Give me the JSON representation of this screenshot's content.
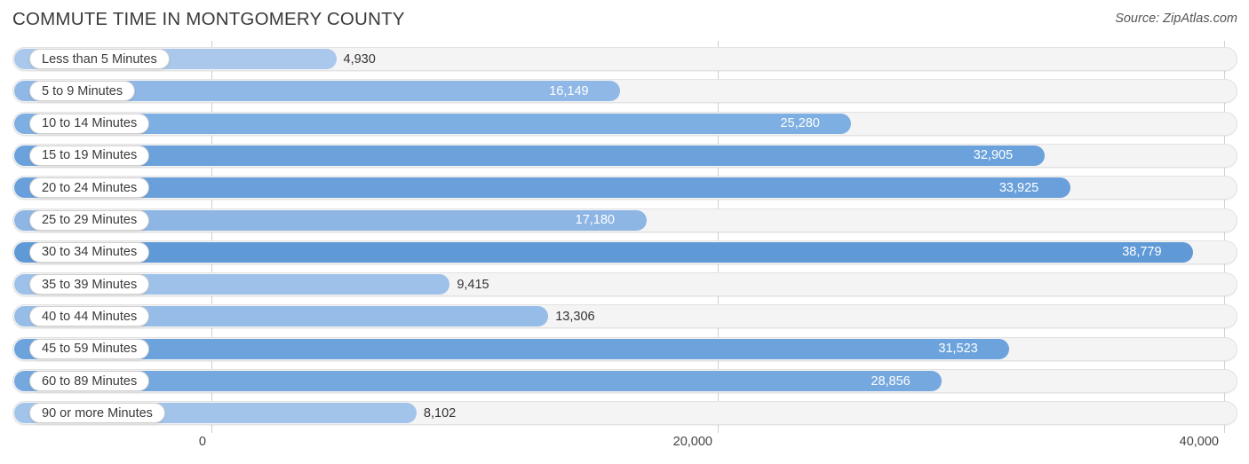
{
  "header": {
    "title": "COMMUTE TIME IN MONTGOMERY COUNTY",
    "source": "Source: ZipAtlas.com"
  },
  "chart_data": {
    "type": "bar",
    "orientation": "horizontal",
    "title": "COMMUTE TIME IN MONTGOMERY COUNTY",
    "subtitle": "",
    "xlabel": "",
    "ylabel": "",
    "xlim": [
      0,
      40000
    ],
    "grid": true,
    "legend": null,
    "axis_ticks": [
      "0",
      "20,000",
      "40,000"
    ],
    "axis_tick_values": [
      0,
      20000,
      40000
    ],
    "categories": [
      "Less than 5 Minutes",
      "5 to 9 Minutes",
      "10 to 14 Minutes",
      "15 to 19 Minutes",
      "20 to 24 Minutes",
      "25 to 29 Minutes",
      "30 to 34 Minutes",
      "35 to 39 Minutes",
      "40 to 44 Minutes",
      "45 to 59 Minutes",
      "60 to 89 Minutes",
      "90 or more Minutes"
    ],
    "values": [
      4930,
      16149,
      25280,
      32905,
      33925,
      17180,
      38779,
      9415,
      13306,
      31523,
      28856,
      8102
    ],
    "value_labels": [
      "4,930",
      "16,149",
      "25,280",
      "32,905",
      "33,925",
      "17,180",
      "38,779",
      "9,415",
      "13,306",
      "31,523",
      "28,856",
      "8,102"
    ],
    "bar_colors": [
      "#a9c8ec",
      "#8fb8e6",
      "#7eafe2",
      "#6ba2dc",
      "#69a0db",
      "#8db6e5",
      "#5f9ad7",
      "#9ec1ea",
      "#96bde8",
      "#6da3dd",
      "#75a8de",
      "#a2c4eb"
    ],
    "track_color": "#f4f4f4",
    "accent_color": "#5f9ad7"
  }
}
